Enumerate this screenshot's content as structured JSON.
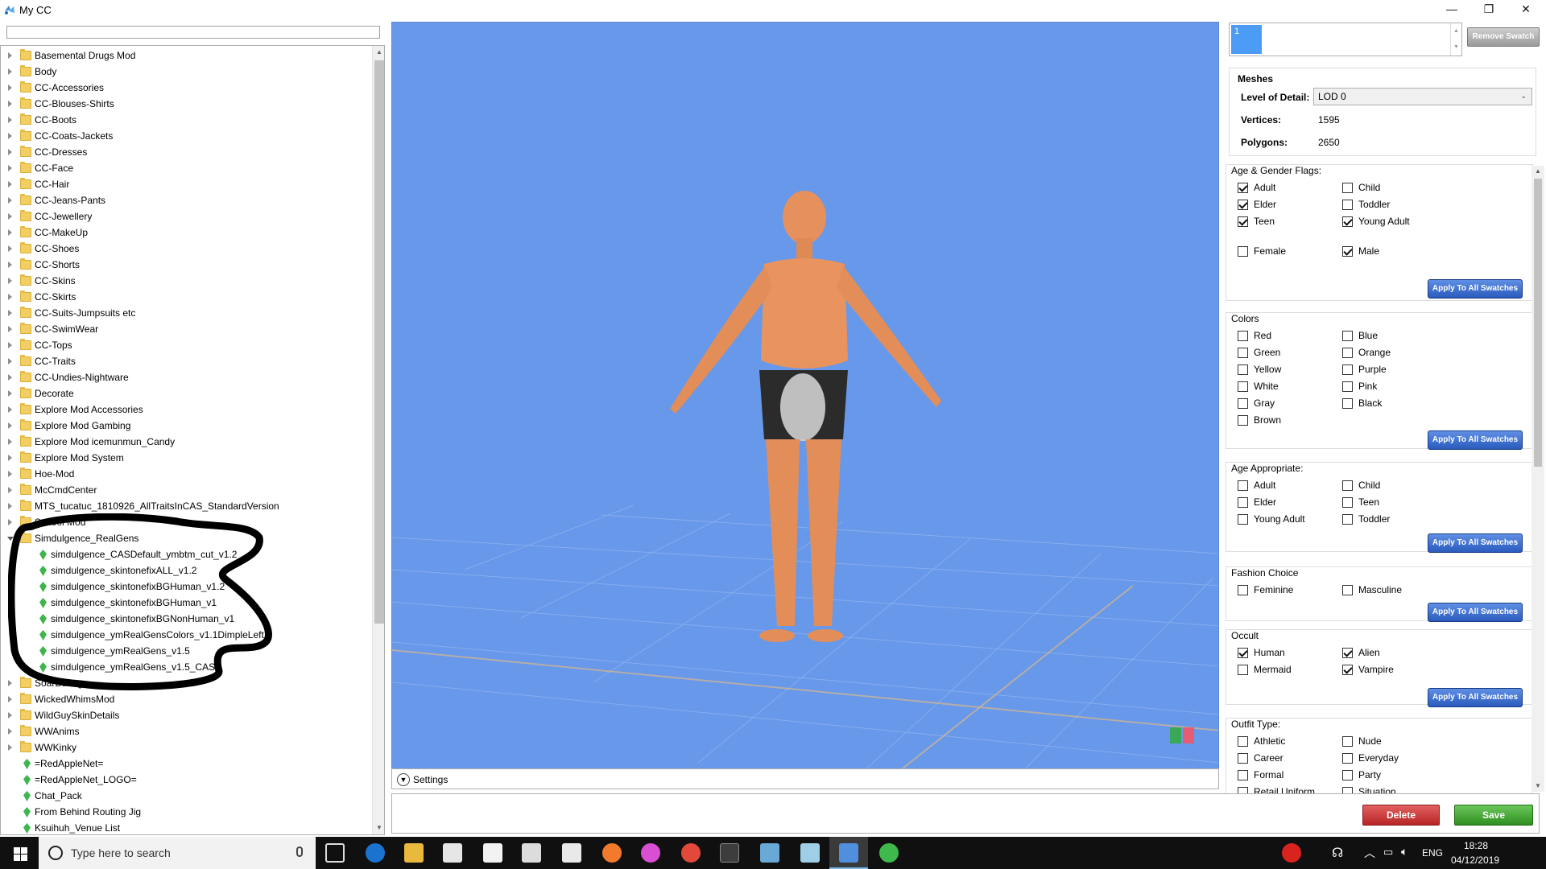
{
  "window": {
    "title": "My CC",
    "minimize_glyph": "—",
    "restore_glyph": "❐",
    "close_glyph": "✕"
  },
  "search": {
    "placeholder": ""
  },
  "tree": {
    "items": [
      {
        "label": "Basemental Drugs Mod",
        "kind": "folder",
        "level": 0
      },
      {
        "label": "Body",
        "kind": "folder",
        "level": 0
      },
      {
        "label": "CC-Accessories",
        "kind": "folder",
        "level": 0
      },
      {
        "label": "CC-Blouses-Shirts",
        "kind": "folder",
        "level": 0
      },
      {
        "label": "CC-Boots",
        "kind": "folder",
        "level": 0
      },
      {
        "label": "CC-Coats-Jackets",
        "kind": "folder",
        "level": 0
      },
      {
        "label": "CC-Dresses",
        "kind": "folder",
        "level": 0
      },
      {
        "label": "CC-Face",
        "kind": "folder",
        "level": 0
      },
      {
        "label": "CC-Hair",
        "kind": "folder",
        "level": 0
      },
      {
        "label": "CC-Jeans-Pants",
        "kind": "folder",
        "level": 0
      },
      {
        "label": "CC-Jewellery",
        "kind": "folder",
        "level": 0
      },
      {
        "label": "CC-MakeUp",
        "kind": "folder",
        "level": 0
      },
      {
        "label": "CC-Shoes",
        "kind": "folder",
        "level": 0
      },
      {
        "label": "CC-Shorts",
        "kind": "folder",
        "level": 0
      },
      {
        "label": "CC-Skins",
        "kind": "folder",
        "level": 0
      },
      {
        "label": "CC-Skirts",
        "kind": "folder",
        "level": 0
      },
      {
        "label": "CC-Suits-Jumpsuits etc",
        "kind": "folder",
        "level": 0
      },
      {
        "label": "CC-SwimWear",
        "kind": "folder",
        "level": 0
      },
      {
        "label": "CC-Tops",
        "kind": "folder",
        "level": 0
      },
      {
        "label": "CC-Traits",
        "kind": "folder",
        "level": 0
      },
      {
        "label": "CC-Undies-Nightware",
        "kind": "folder",
        "level": 0
      },
      {
        "label": "Decorate",
        "kind": "folder",
        "level": 0
      },
      {
        "label": "Explore Mod Accessories",
        "kind": "folder",
        "level": 0
      },
      {
        "label": "Explore Mod Gambing",
        "kind": "folder",
        "level": 0
      },
      {
        "label": "Explore Mod icemunmun_Candy",
        "kind": "folder",
        "level": 0
      },
      {
        "label": "Explore Mod System",
        "kind": "folder",
        "level": 0
      },
      {
        "label": "Hoe-Mod",
        "kind": "folder",
        "level": 0
      },
      {
        "label": "McCmdCenter",
        "kind": "folder",
        "level": 0
      },
      {
        "label": "MTS_tucatuc_1810926_AllTraitsInCAS_StandardVersion",
        "kind": "folder",
        "level": 0
      },
      {
        "label": "School Mod",
        "kind": "folder",
        "level": 0
      },
      {
        "label": "Simdulgence_RealGens",
        "kind": "folder-open",
        "level": 0
      },
      {
        "label": "simdulgence_CASDefault_ymbtm_cut_v1.2",
        "kind": "file",
        "level": 1
      },
      {
        "label": "simdulgence_skintonefixALL_v1.2",
        "kind": "file",
        "level": 1
      },
      {
        "label": "simdulgence_skintonefixBGHuman_v1.2",
        "kind": "file",
        "level": 1
      },
      {
        "label": "simdulgence_skintonefixBGHuman_v1",
        "kind": "file",
        "level": 1
      },
      {
        "label": "simdulgence_skintonefixBGNonHuman_v1",
        "kind": "file",
        "level": 1
      },
      {
        "label": "simdulgence_ymRealGensColors_v1.1DimpleLeft",
        "kind": "file",
        "level": 1
      },
      {
        "label": "simdulgence_ymRealGens_v1.5",
        "kind": "file",
        "level": 1
      },
      {
        "label": "simdulgence_ymRealGens_v1.5_CAS",
        "kind": "file",
        "level": 1
      },
      {
        "label": "SoarDating",
        "kind": "folder",
        "level": 0
      },
      {
        "label": "WickedWhimsMod",
        "kind": "folder",
        "level": 0
      },
      {
        "label": "WildGuySkinDetails",
        "kind": "folder",
        "level": 0
      },
      {
        "label": "WWAnims",
        "kind": "folder",
        "level": 0
      },
      {
        "label": "WWKinky",
        "kind": "folder",
        "level": 0
      },
      {
        "label": "=RedAppleNet=",
        "kind": "file",
        "level": 0
      },
      {
        "label": "=RedAppleNet_LOGO=",
        "kind": "file",
        "level": 0
      },
      {
        "label": "Chat_Pack",
        "kind": "file",
        "level": 0
      },
      {
        "label": "From Behind Routing Jig",
        "kind": "file",
        "level": 0
      },
      {
        "label": "Ksuihuh_Venue List",
        "kind": "file",
        "level": 0
      }
    ]
  },
  "viewport": {
    "settings_label": "Settings",
    "bg_color": "#6798e9"
  },
  "swatch": {
    "selected": "1",
    "remove_label": "Remove Swatch"
  },
  "meshes": {
    "title": "Meshes",
    "lod_label": "Level of Detail:",
    "lod_value": "LOD 0",
    "vertices_label": "Vertices:",
    "vertices_value": "1595",
    "polygons_label": "Polygons:",
    "polygons_value": "2650"
  },
  "apply_label": "Apply To All Swatches",
  "groups": {
    "age_gender": {
      "title": "Age & Gender Flags:",
      "options": [
        {
          "label": "Adult",
          "checked": true
        },
        {
          "label": "Child",
          "checked": false
        },
        {
          "label": "Elder",
          "checked": true
        },
        {
          "label": "Toddler",
          "checked": false
        },
        {
          "label": "Teen",
          "checked": true
        },
        {
          "label": "Young Adult",
          "checked": true
        },
        {
          "label": "Female",
          "checked": false
        },
        {
          "label": "Male",
          "checked": true
        }
      ]
    },
    "colors": {
      "title": "Colors",
      "options": [
        {
          "label": "Red",
          "checked": false
        },
        {
          "label": "Blue",
          "checked": false
        },
        {
          "label": "Green",
          "checked": false
        },
        {
          "label": "Orange",
          "checked": false
        },
        {
          "label": "Yellow",
          "checked": false
        },
        {
          "label": "Purple",
          "checked": false
        },
        {
          "label": "White",
          "checked": false
        },
        {
          "label": "Pink",
          "checked": false
        },
        {
          "label": "Gray",
          "checked": false
        },
        {
          "label": "Black",
          "checked": false
        },
        {
          "label": "Brown",
          "checked": false
        }
      ]
    },
    "age_appropriate": {
      "title": "Age Appropriate:",
      "options": [
        {
          "label": "Adult",
          "checked": false
        },
        {
          "label": "Child",
          "checked": false
        },
        {
          "label": "Elder",
          "checked": false
        },
        {
          "label": "Teen",
          "checked": false
        },
        {
          "label": "Young Adult",
          "checked": false
        },
        {
          "label": "Toddler",
          "checked": false
        }
      ]
    },
    "fashion": {
      "title": "Fashion Choice",
      "options": [
        {
          "label": "Feminine",
          "checked": false
        },
        {
          "label": "Masculine",
          "checked": false
        }
      ]
    },
    "occult": {
      "title": "Occult",
      "options": [
        {
          "label": "Human",
          "checked": true
        },
        {
          "label": "Alien",
          "checked": true
        },
        {
          "label": "Mermaid",
          "checked": false
        },
        {
          "label": "Vampire",
          "checked": true
        }
      ]
    },
    "outfit": {
      "title": "Outfit Type:",
      "options": [
        {
          "label": "Athletic",
          "checked": false
        },
        {
          "label": "Nude",
          "checked": false
        },
        {
          "label": "Career",
          "checked": false
        },
        {
          "label": "Everyday",
          "checked": false
        },
        {
          "label": "Formal",
          "checked": false
        },
        {
          "label": "Party",
          "checked": false
        },
        {
          "label": "Retail Uniform",
          "checked": false
        },
        {
          "label": "Situation",
          "checked": false
        }
      ]
    }
  },
  "actions": {
    "delete_label": "Delete",
    "save_label": "Save"
  },
  "taskbar": {
    "search_placeholder": "Type here to search",
    "lang": "ENG",
    "time": "18:28",
    "date": "04/12/2019"
  }
}
